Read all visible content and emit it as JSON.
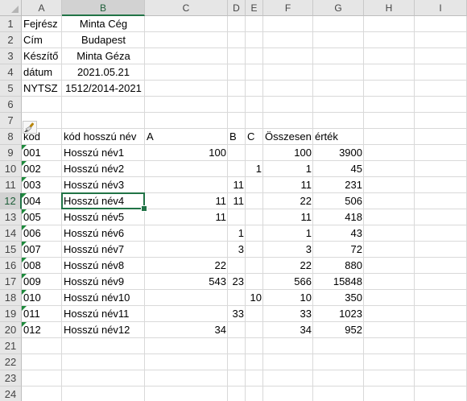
{
  "columns": [
    "A",
    "B",
    "C",
    "D",
    "E",
    "F",
    "G",
    "H",
    "I"
  ],
  "rows": [
    "1",
    "2",
    "3",
    "4",
    "5",
    "6",
    "7",
    "8",
    "9",
    "10",
    "11",
    "12",
    "13",
    "14",
    "15",
    "16",
    "17",
    "18",
    "19",
    "20",
    "21",
    "22",
    "23",
    "24"
  ],
  "header_block": [
    {
      "label": "Fejrész",
      "value": "Minta Cég"
    },
    {
      "label": "Cím",
      "value": "Budapest"
    },
    {
      "label": "Készítő",
      "value": "Minta Géza"
    },
    {
      "label": "dátum",
      "value": "2021.05.21"
    },
    {
      "label": "NYTSZ",
      "value": "1512/2014-2021"
    }
  ],
  "table_headers": [
    "kód",
    "kód hosszú név",
    "A",
    "B",
    "C",
    "Összesen",
    "érték"
  ],
  "table_rows": [
    {
      "kod": "001",
      "nev": "Hosszú név1",
      "a": "100",
      "b": "",
      "c": "",
      "ossz": "100",
      "ertek": "3900"
    },
    {
      "kod": "002",
      "nev": "Hosszú név2",
      "a": "",
      "b": "",
      "c": "1",
      "ossz": "1",
      "ertek": "45"
    },
    {
      "kod": "003",
      "nev": "Hosszú név3",
      "a": "",
      "b": "11",
      "c": "",
      "ossz": "11",
      "ertek": "231"
    },
    {
      "kod": "004",
      "nev": "Hosszú név4",
      "a": "11",
      "b": "11",
      "c": "",
      "ossz": "22",
      "ertek": "506"
    },
    {
      "kod": "005",
      "nev": "Hosszú név5",
      "a": "11",
      "b": "",
      "c": "",
      "ossz": "11",
      "ertek": "418"
    },
    {
      "kod": "006",
      "nev": "Hosszú név6",
      "a": "",
      "b": "1",
      "c": "",
      "ossz": "1",
      "ertek": "43"
    },
    {
      "kod": "007",
      "nev": "Hosszú név7",
      "a": "",
      "b": "3",
      "c": "",
      "ossz": "3",
      "ertek": "72"
    },
    {
      "kod": "008",
      "nev": "Hosszú név8",
      "a": "22",
      "b": "",
      "c": "",
      "ossz": "22",
      "ertek": "880"
    },
    {
      "kod": "009",
      "nev": "Hosszú név9",
      "a": "543",
      "b": "23",
      "c": "",
      "ossz": "566",
      "ertek": "15848"
    },
    {
      "kod": "010",
      "nev": "Hosszú név10",
      "a": "",
      "b": "",
      "c": "10",
      "ossz": "10",
      "ertek": "350"
    },
    {
      "kod": "011",
      "nev": "Hosszú név11",
      "a": "",
      "b": "33",
      "c": "",
      "ossz": "33",
      "ertek": "1023"
    },
    {
      "kod": "012",
      "nev": "Hosszú név12",
      "a": "34",
      "b": "",
      "c": "",
      "ossz": "34",
      "ertek": "952"
    }
  ],
  "active_cell": {
    "column": "B",
    "row": "12"
  },
  "colors": {
    "accent": "#217346",
    "error_indicator": "#1e8a3c",
    "gridline": "#d9d9d9"
  },
  "icons": {
    "paste_options": "paintbrush-icon"
  }
}
